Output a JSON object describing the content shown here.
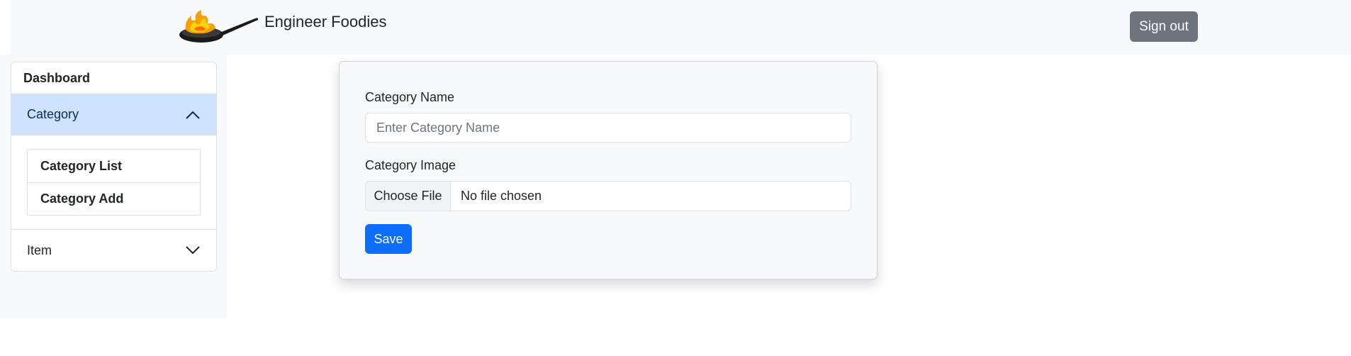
{
  "navbar": {
    "brand_name": "Engineer Foodies",
    "logo_icon": "chef-pan-flame-logo",
    "signout_label": "Sign out"
  },
  "sidebar": {
    "dashboard_label": "Dashboard",
    "category": {
      "label": "Category",
      "expanded": true,
      "chevron_icon": "chevron-up-icon",
      "items": [
        {
          "label": "Category List"
        },
        {
          "label": "Category Add"
        }
      ]
    },
    "item": {
      "label": "Item",
      "expanded": false,
      "chevron_icon": "chevron-down-icon"
    }
  },
  "form": {
    "name_label": "Category Name",
    "name_value": "",
    "name_placeholder": "Enter Category Name",
    "image_label": "Category Image",
    "file_button_label": "Choose File",
    "file_status": "No file chosen",
    "save_label": "Save"
  },
  "colors": {
    "primary": "#0d6efd",
    "secondary": "#6c757d",
    "active_accordion": "#cfe2ff",
    "light_bg": "#f8f9fa"
  }
}
